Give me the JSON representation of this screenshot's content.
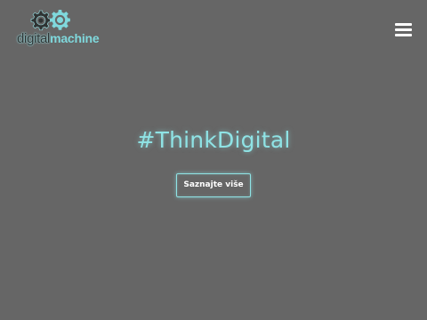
{
  "header": {
    "logo": {
      "text_part1": "digital",
      "text_part2": "machine",
      "icons": [
        "gear-icon",
        "gear-icon"
      ]
    },
    "menu_icon": "hamburger-menu-icon"
  },
  "hero": {
    "title": "#ThinkDigital",
    "button_label": "Saznajte više"
  },
  "colors": {
    "background": "#666666",
    "accent": "#8fe3e5",
    "logo_dark": "#2f3333",
    "text_light": "#ffffff"
  }
}
